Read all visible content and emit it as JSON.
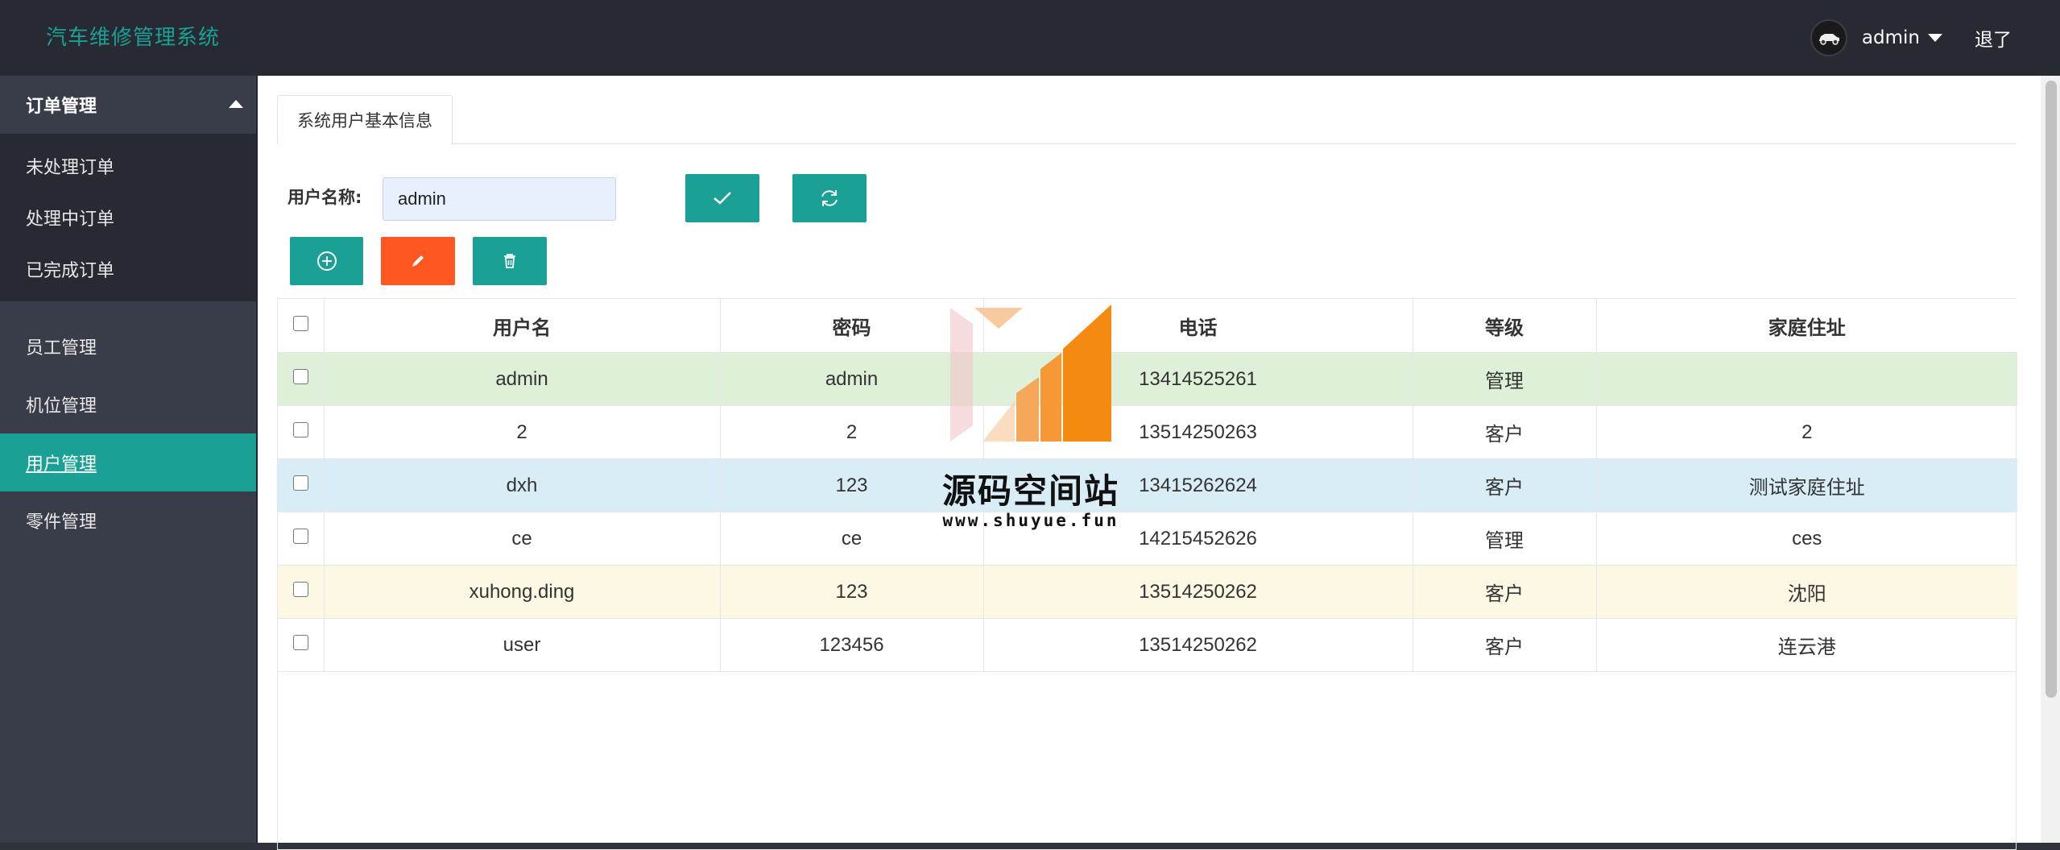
{
  "app": {
    "title": "汽车维修管理系统"
  },
  "header": {
    "username": "admin",
    "logout_label": "退了"
  },
  "sidebar": {
    "group_title": "订单管理",
    "sub_items": [
      "未处理订单",
      "处理中订单",
      "已完成订单"
    ],
    "items": [
      {
        "label": "员工管理",
        "active": false
      },
      {
        "label": "机位管理",
        "active": false
      },
      {
        "label": "用户管理",
        "active": true
      },
      {
        "label": "零件管理",
        "active": false
      }
    ]
  },
  "main": {
    "tab_label": "系统用户基本信息",
    "search": {
      "label": "用户名称:",
      "value": "admin"
    },
    "buttons": {
      "confirm": "check-icon",
      "refresh": "refresh-icon",
      "add": "plus-circle-icon",
      "edit": "pencil-icon",
      "delete": "trash-icon"
    },
    "table": {
      "headers": [
        "用户名",
        "密码",
        "电话",
        "等级",
        "家庭住址"
      ],
      "rows": [
        {
          "username": "admin",
          "password": "admin",
          "phone": "13414525261",
          "level": "管理",
          "address": "",
          "style": "green"
        },
        {
          "username": "2",
          "password": "2",
          "phone": "13514250263",
          "level": "客户",
          "address": "2",
          "style": ""
        },
        {
          "username": "dxh",
          "password": "123",
          "phone": "13415262624",
          "level": "客户",
          "address": "测试家庭住址",
          "style": "blue"
        },
        {
          "username": "ce",
          "password": "ce",
          "phone": "14215452626",
          "level": "管理",
          "address": "ces",
          "style": ""
        },
        {
          "username": "xuhong.ding",
          "password": "123",
          "phone": "13514250262",
          "level": "客户",
          "address": "沈阳",
          "style": "yellow"
        },
        {
          "username": "user",
          "password": "123456",
          "phone": "13514250262",
          "level": "客户",
          "address": "连云港",
          "style": ""
        }
      ]
    }
  },
  "watermark": {
    "title": "源码空间站",
    "url": "www.shuyue.fun"
  },
  "colors": {
    "accent": "#1aa094",
    "danger": "#ff5722",
    "topbar": "#272a33",
    "sidebar": "#393d49"
  }
}
